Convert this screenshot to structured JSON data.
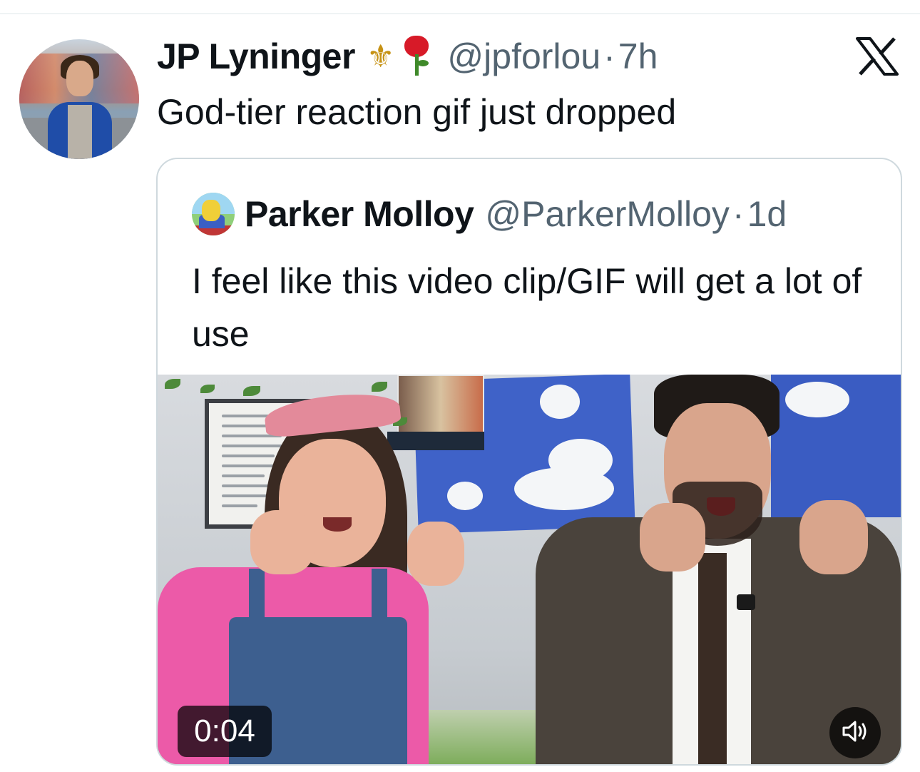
{
  "tweet": {
    "author_name": "JP Lyninger",
    "author_badges": [
      "fleur-de-lis-icon",
      "rose-icon"
    ],
    "fleur_glyph": "⚜",
    "handle": "@jpforlou",
    "separator": "·",
    "time": "7h",
    "text": "God-tier reaction gif just dropped",
    "platform_icon": "x-logo-icon"
  },
  "quote": {
    "author_name": "Parker Molloy",
    "handle": "@ParkerMolloy",
    "separator": "·",
    "time": "1d",
    "text": "I feel like this video clip/GIF will get a lot of use",
    "media": {
      "type": "video",
      "duration": "0:04",
      "audio_icon": "speaker-icon"
    }
  },
  "colors": {
    "text_primary": "#0f1419",
    "text_secondary": "#536471",
    "border": "#cfd9de",
    "background": "#ffffff"
  }
}
